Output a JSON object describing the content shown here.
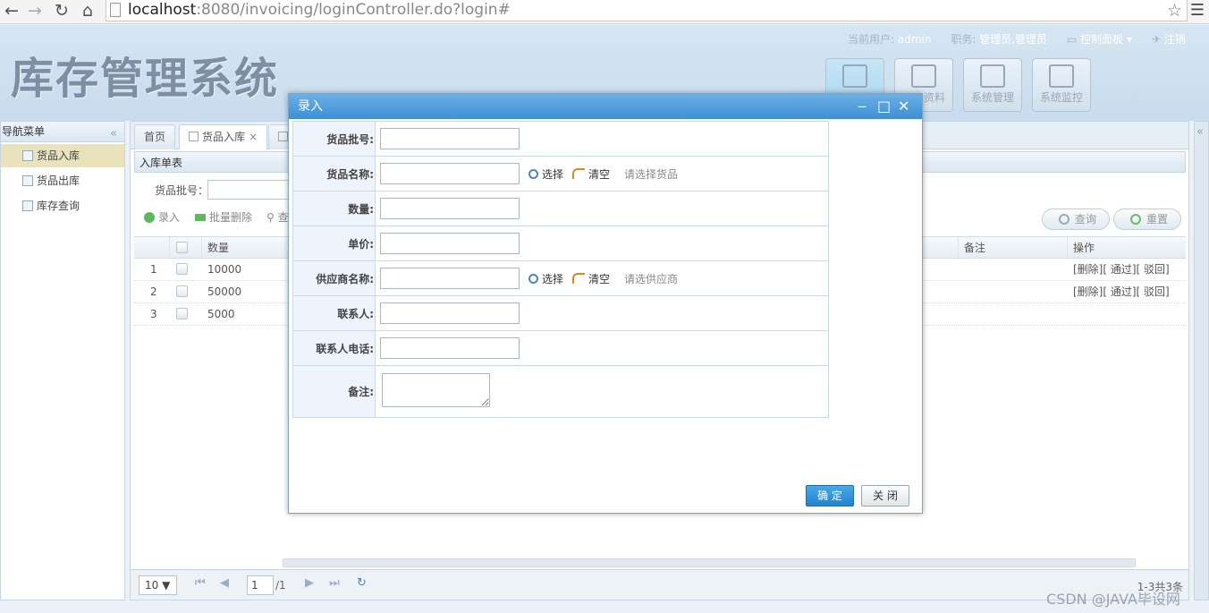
{
  "browser": {
    "url_host": "localhost",
    "url_rest": ":8080/invoicing/loginController.do?login#"
  },
  "header": {
    "logo": "库存管理系统",
    "user_label": "当前用户:",
    "user_value": "admin",
    "role_label": "职务:",
    "role_value": "管理员,管理员",
    "control_panel": "控制面板",
    "logout": "注销",
    "top_buttons": [
      {
        "label": ""
      },
      {
        "label": "资料"
      },
      {
        "label": "系统管理"
      },
      {
        "label": "系统监控"
      }
    ]
  },
  "sidebar": {
    "title": "导航菜单",
    "items": [
      {
        "label": "货品入库"
      },
      {
        "label": "货品出库"
      },
      {
        "label": "库存查询"
      }
    ]
  },
  "tabs": [
    {
      "label": "首页"
    },
    {
      "label": "货品入库"
    }
  ],
  "panel": {
    "title": "入库单表",
    "search_label": "货品批号：",
    "toolbar": {
      "add": "录入",
      "batch_delete": "批量删除",
      "query_short": "查"
    },
    "query_button": "查询",
    "reset_button": "重置"
  },
  "grid": {
    "columns": {
      "qty": "数量",
      "remark": "备注",
      "ops": "操作"
    },
    "rows": [
      {
        "no": "1",
        "qty": "10000",
        "ops": "[删除][ 通过][ 驳回]"
      },
      {
        "no": "2",
        "qty": "50000",
        "ops": "[删除][ 通过][ 驳回]"
      },
      {
        "no": "3",
        "qty": "5000",
        "ops": ""
      }
    ]
  },
  "pager": {
    "page_size": "10 ▼",
    "page": "1",
    "total_pages": "/1",
    "info": "1-3共3条"
  },
  "dialog": {
    "title": "录入",
    "fields": {
      "batch": "货品批号:",
      "name": "货品名称:",
      "qty": "数量:",
      "price": "单价:",
      "supplier": "供应商名称:",
      "contact": "联系人:",
      "phone": "联系人电话:",
      "remark": "备注:"
    },
    "select_label": "选择",
    "clear_label": "清空",
    "name_hint": "请选择货品",
    "supplier_hint": "请选供应商",
    "ok": "确 定",
    "close": "关 闭"
  },
  "watermark": "CSDN @JAVA毕设网"
}
